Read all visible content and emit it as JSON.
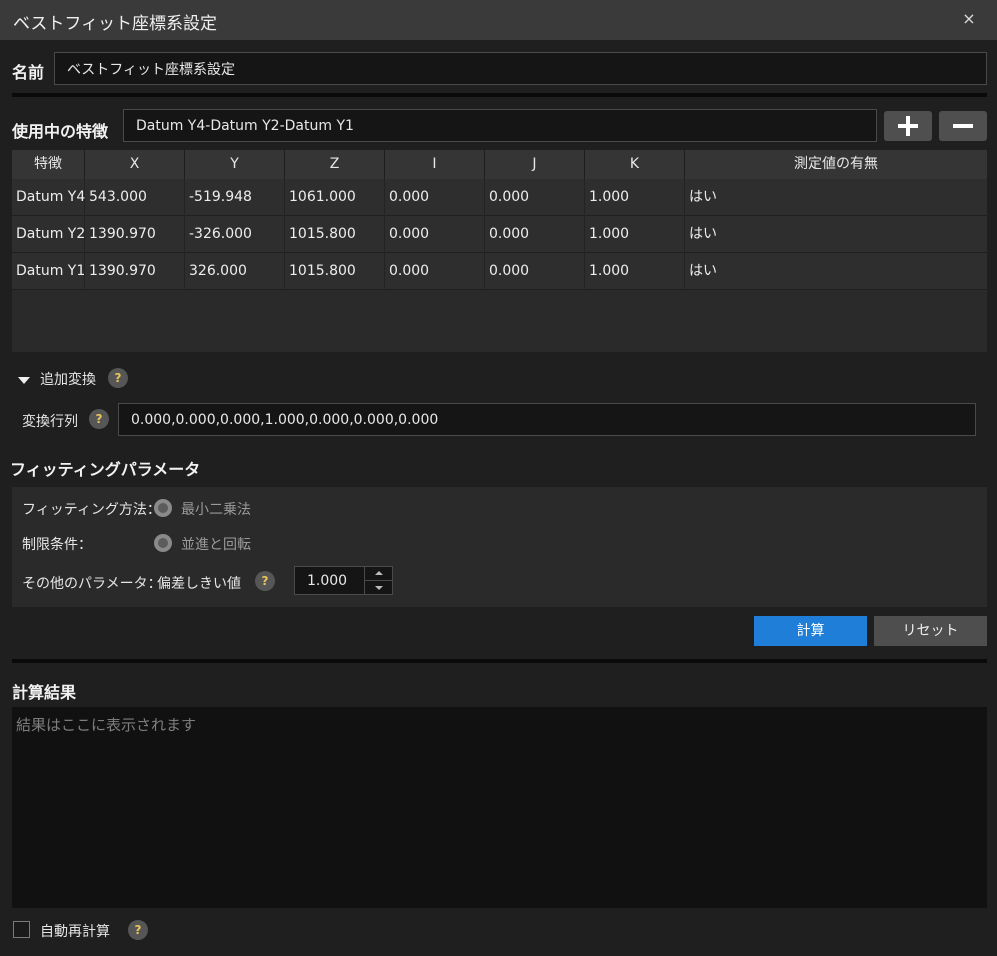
{
  "window": {
    "title": "ベストフィット座標系設定",
    "close_label": "×"
  },
  "name_field": {
    "label": "名前",
    "value": "ベストフィット座標系設定"
  },
  "features": {
    "label": "使用中の特徴",
    "value": "Datum Y4-Datum Y2-Datum Y1"
  },
  "table": {
    "headers": [
      "特徴",
      "X",
      "Y",
      "Z",
      "I",
      "J",
      "K",
      "測定値の有無"
    ],
    "rows": [
      [
        "Datum Y4",
        "543.000",
        "-519.948",
        "1061.000",
        "0.000",
        "0.000",
        "1.000",
        "はい"
      ],
      [
        "Datum Y2",
        "1390.970",
        "-326.000",
        "1015.800",
        "0.000",
        "0.000",
        "1.000",
        "はい"
      ],
      [
        "Datum Y1",
        "1390.970",
        "326.000",
        "1015.800",
        "0.000",
        "0.000",
        "1.000",
        "はい"
      ]
    ]
  },
  "extra_transform": {
    "section_label": "追加変換",
    "matrix_label": "変換行列",
    "matrix_value": "0.000,0.000,0.000,1.000,0.000,0.000,0.000"
  },
  "fitting": {
    "heading": "フィッティングパラメータ",
    "method_label": "フィッティング方法：",
    "method_value": "最小二乗法",
    "constraint_label": "制限条件：",
    "constraint_value": "並進と回転",
    "other_label": "その他のパラメータ：",
    "tolerance_label": "偏差しきい値",
    "tolerance_value": "1.000"
  },
  "actions": {
    "calculate": "計算",
    "reset": "リセット"
  },
  "results": {
    "heading": "計算結果",
    "placeholder": "結果はここに表示されます"
  },
  "auto_recalc": {
    "label": "自動再計算",
    "checked": false
  },
  "help_glyph": "?"
}
